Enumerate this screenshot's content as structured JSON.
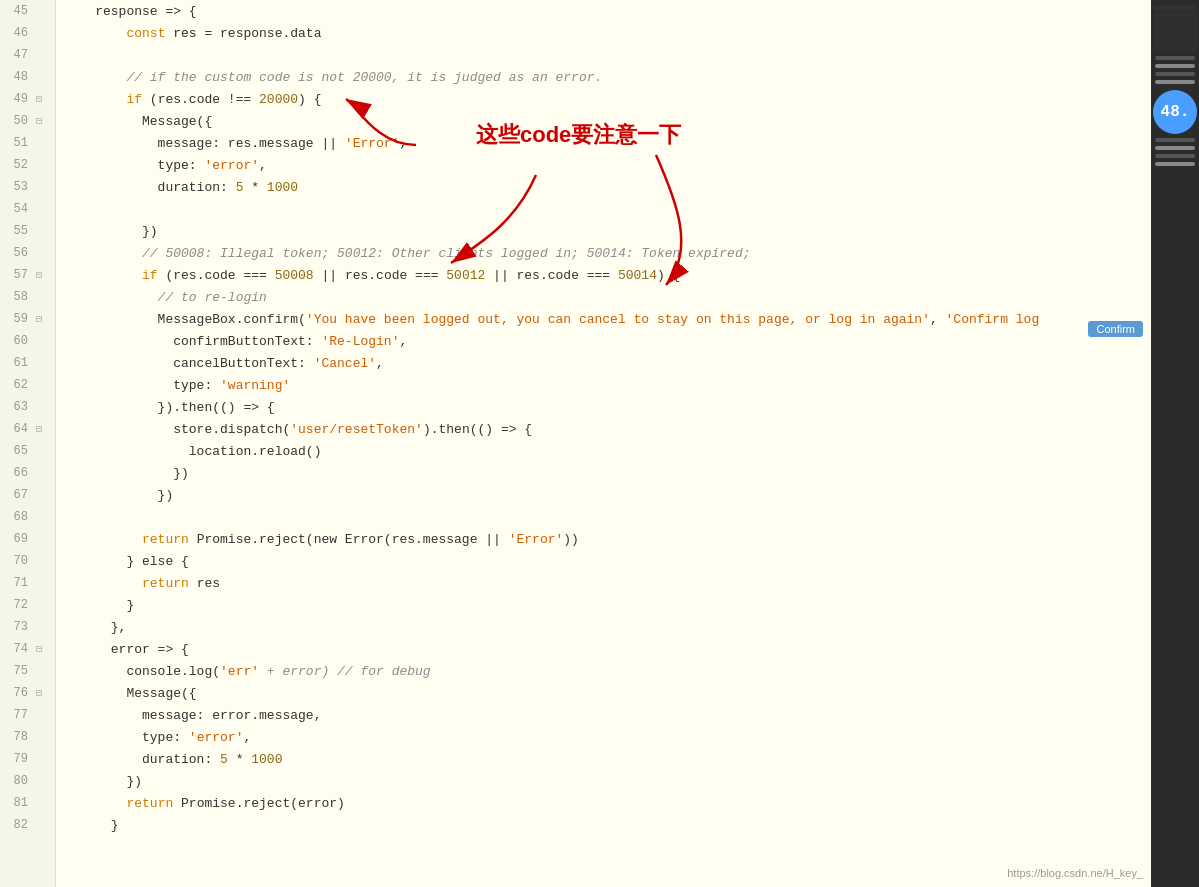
{
  "lines": [
    {
      "num": 45,
      "fold": false,
      "tokens": [
        {
          "t": "    response => {",
          "c": "plain"
        }
      ]
    },
    {
      "num": 46,
      "fold": false,
      "tokens": [
        {
          "t": "        ",
          "c": "plain"
        },
        {
          "t": "const",
          "c": "kw"
        },
        {
          "t": " res = response.data",
          "c": "plain"
        }
      ]
    },
    {
      "num": 47,
      "fold": false,
      "tokens": []
    },
    {
      "num": 48,
      "fold": false,
      "tokens": [
        {
          "t": "        // if the custom code is not 20000, it is judged as an error.",
          "c": "cmt"
        }
      ]
    },
    {
      "num": 49,
      "fold": true,
      "tokens": [
        {
          "t": "        ",
          "c": "plain"
        },
        {
          "t": "if",
          "c": "kw"
        },
        {
          "t": " (res.code !== ",
          "c": "plain"
        },
        {
          "t": "20000",
          "c": "num"
        },
        {
          "t": ") {",
          "c": "plain"
        }
      ]
    },
    {
      "num": 50,
      "fold": true,
      "tokens": [
        {
          "t": "          Message({",
          "c": "plain"
        }
      ]
    },
    {
      "num": 51,
      "fold": false,
      "tokens": [
        {
          "t": "            message: res.message || ",
          "c": "plain"
        },
        {
          "t": "'Error'",
          "c": "str"
        },
        {
          "t": ",",
          "c": "plain"
        }
      ]
    },
    {
      "num": 52,
      "fold": false,
      "tokens": [
        {
          "t": "            type: ",
          "c": "plain"
        },
        {
          "t": "'error'",
          "c": "str"
        },
        {
          "t": ",",
          "c": "plain"
        }
      ]
    },
    {
      "num": 53,
      "fold": false,
      "tokens": [
        {
          "t": "            duration: ",
          "c": "plain"
        },
        {
          "t": "5",
          "c": "num"
        },
        {
          "t": " * ",
          "c": "plain"
        },
        {
          "t": "1000",
          "c": "num"
        }
      ]
    },
    {
      "num": 54,
      "fold": false,
      "tokens": []
    },
    {
      "num": 55,
      "fold": false,
      "tokens": [
        {
          "t": "          })",
          "c": "plain"
        }
      ]
    },
    {
      "num": 56,
      "fold": false,
      "tokens": [
        {
          "t": "          // 50008: Illegal token; 50012: Other clients logged in; 50014: Token expired;",
          "c": "cmt"
        }
      ]
    },
    {
      "num": 57,
      "fold": true,
      "tokens": [
        {
          "t": "          ",
          "c": "plain"
        },
        {
          "t": "if",
          "c": "kw"
        },
        {
          "t": " (res.code === ",
          "c": "plain"
        },
        {
          "t": "50008",
          "c": "num"
        },
        {
          "t": " || res.code === ",
          "c": "plain"
        },
        {
          "t": "50012",
          "c": "num"
        },
        {
          "t": " || res.code === ",
          "c": "plain"
        },
        {
          "t": "50014",
          "c": "num"
        },
        {
          "t": ") {",
          "c": "plain"
        }
      ]
    },
    {
      "num": 58,
      "fold": false,
      "tokens": [
        {
          "t": "            // to re-login",
          "c": "cmt"
        }
      ]
    },
    {
      "num": 59,
      "fold": true,
      "tokens": [
        {
          "t": "            MessageBox.confirm(",
          "c": "plain"
        },
        {
          "t": "'You have been logged out, you can cancel to stay on this page, or log in again'",
          "c": "str"
        },
        {
          "t": ", ",
          "c": "plain"
        },
        {
          "t": "'Confirm log",
          "c": "str"
        }
      ]
    },
    {
      "num": 60,
      "fold": false,
      "tokens": [
        {
          "t": "              confirmButtonText: ",
          "c": "plain"
        },
        {
          "t": "'Re-Login'",
          "c": "str"
        },
        {
          "t": ",",
          "c": "plain"
        }
      ]
    },
    {
      "num": 61,
      "fold": false,
      "tokens": [
        {
          "t": "              cancelButtonText: ",
          "c": "plain"
        },
        {
          "t": "'Cancel'",
          "c": "str"
        },
        {
          "t": ",",
          "c": "plain"
        }
      ]
    },
    {
      "num": 62,
      "fold": false,
      "tokens": [
        {
          "t": "              type: ",
          "c": "plain"
        },
        {
          "t": "'warning'",
          "c": "str"
        }
      ]
    },
    {
      "num": 63,
      "fold": false,
      "tokens": [
        {
          "t": "            }).then(() => {",
          "c": "plain"
        }
      ]
    },
    {
      "num": 64,
      "fold": true,
      "tokens": [
        {
          "t": "              store.dispatch(",
          "c": "plain"
        },
        {
          "t": "'user/resetToken'",
          "c": "str"
        },
        {
          "t": ").then(() => {",
          "c": "plain"
        }
      ]
    },
    {
      "num": 65,
      "fold": false,
      "tokens": [
        {
          "t": "                location.reload()",
          "c": "plain"
        }
      ]
    },
    {
      "num": 66,
      "fold": false,
      "tokens": [
        {
          "t": "              })",
          "c": "plain"
        }
      ]
    },
    {
      "num": 67,
      "fold": false,
      "tokens": [
        {
          "t": "            })",
          "c": "plain"
        }
      ]
    },
    {
      "num": 68,
      "fold": false,
      "tokens": []
    },
    {
      "num": 69,
      "fold": false,
      "tokens": [
        {
          "t": "          ",
          "c": "plain"
        },
        {
          "t": "return",
          "c": "kw"
        },
        {
          "t": " Promise.reject(new Error(res.message || ",
          "c": "plain"
        },
        {
          "t": "'Error'",
          "c": "str"
        },
        {
          "t": "))",
          "c": "plain"
        }
      ]
    },
    {
      "num": 70,
      "fold": false,
      "tokens": [
        {
          "t": "        } else {",
          "c": "plain"
        }
      ]
    },
    {
      "num": 71,
      "fold": false,
      "tokens": [
        {
          "t": "          ",
          "c": "plain"
        },
        {
          "t": "return",
          "c": "kw"
        },
        {
          "t": " res",
          "c": "plain"
        }
      ]
    },
    {
      "num": 72,
      "fold": false,
      "tokens": [
        {
          "t": "        }",
          "c": "plain"
        }
      ]
    },
    {
      "num": 73,
      "fold": false,
      "tokens": [
        {
          "t": "      },",
          "c": "plain"
        }
      ]
    },
    {
      "num": 74,
      "fold": true,
      "tokens": [
        {
          "t": "      error => {",
          "c": "plain"
        }
      ]
    },
    {
      "num": 75,
      "fold": false,
      "tokens": [
        {
          "t": "        console.log(",
          "c": "plain"
        },
        {
          "t": "'err'",
          "c": "str"
        },
        {
          "t": " + error) // for debug",
          "c": "cmt"
        }
      ]
    },
    {
      "num": 76,
      "fold": true,
      "tokens": [
        {
          "t": "        Message({",
          "c": "plain"
        }
      ]
    },
    {
      "num": 77,
      "fold": false,
      "tokens": [
        {
          "t": "          message: error.message,",
          "c": "plain"
        }
      ]
    },
    {
      "num": 78,
      "fold": false,
      "tokens": [
        {
          "t": "          type: ",
          "c": "plain"
        },
        {
          "t": "'error'",
          "c": "str"
        },
        {
          "t": ",",
          "c": "plain"
        }
      ]
    },
    {
      "num": 79,
      "fold": false,
      "tokens": [
        {
          "t": "          duration: ",
          "c": "plain"
        },
        {
          "t": "5",
          "c": "num"
        },
        {
          "t": " * ",
          "c": "plain"
        },
        {
          "t": "1000",
          "c": "num"
        }
      ]
    },
    {
      "num": 80,
      "fold": false,
      "tokens": [
        {
          "t": "        })",
          "c": "plain"
        }
      ]
    },
    {
      "num": 81,
      "fold": false,
      "tokens": [
        {
          "t": "        ",
          "c": "plain"
        },
        {
          "t": "return",
          "c": "kw"
        },
        {
          "t": " Promise.reject(error)",
          "c": "plain"
        }
      ]
    },
    {
      "num": 82,
      "fold": false,
      "tokens": [
        {
          "t": "      }",
          "c": "plain"
        }
      ]
    }
  ],
  "annotation": {
    "text": "这些code要注意一下",
    "confirm_label": "Confirm"
  },
  "watermark": "https://blog.csdn.ne/H_key_",
  "sidebar": {
    "number": "48."
  }
}
